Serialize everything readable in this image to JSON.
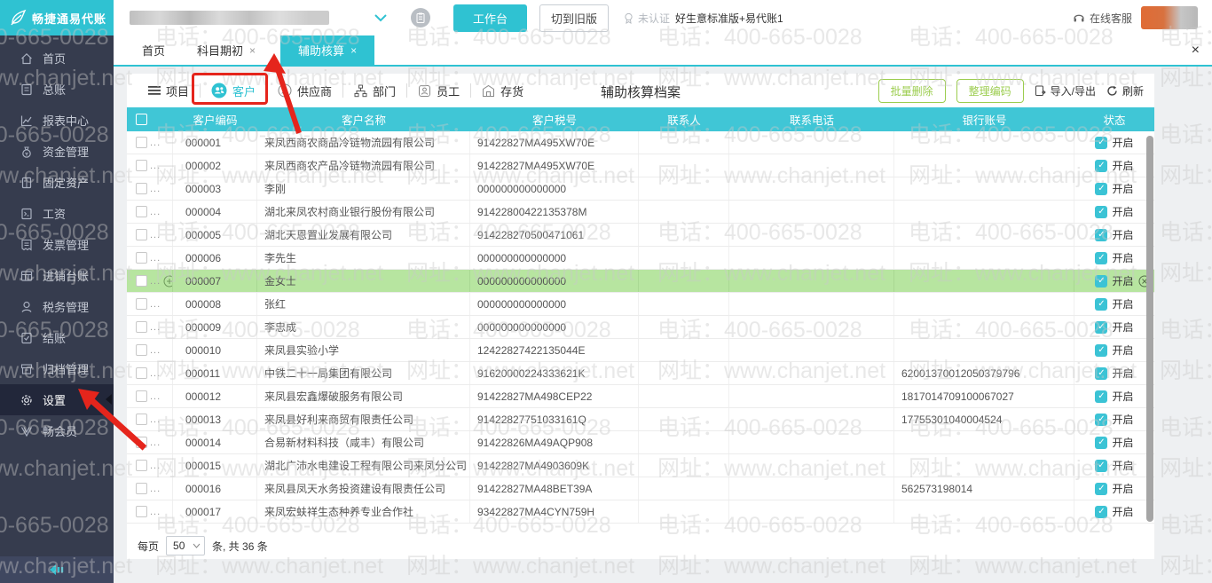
{
  "header": {
    "logo_text": "畅捷通易代账",
    "workbench_button": "工作台",
    "switch_old_button": "切到旧版",
    "cert_badge": "未认证",
    "product_name": "好生意标准版+易代账1",
    "online_service": "在线客服"
  },
  "tabs": {
    "items": [
      {
        "label": "首页",
        "closable": false
      },
      {
        "label": "科目期初",
        "closable": true
      },
      {
        "label": "辅助核算",
        "closable": true,
        "active": true
      }
    ],
    "close_glyph": "×"
  },
  "sidebar": {
    "items": [
      {
        "label": "首页"
      },
      {
        "label": "总账"
      },
      {
        "label": "报表中心"
      },
      {
        "label": "资金管理"
      },
      {
        "label": "固定资产"
      },
      {
        "label": "工资"
      },
      {
        "label": "发票管理"
      },
      {
        "label": "进销台账"
      },
      {
        "label": "税务管理"
      },
      {
        "label": "结账"
      },
      {
        "label": "归档管理"
      },
      {
        "label": "设置",
        "active": true
      },
      {
        "label": "畅会员"
      }
    ]
  },
  "toolbar": {
    "categories": [
      {
        "label": "项目"
      },
      {
        "label": "客户",
        "selected": true
      },
      {
        "label": "供应商"
      },
      {
        "label": "部门"
      },
      {
        "label": "员工"
      },
      {
        "label": "存货"
      }
    ],
    "title": "辅助核算档案",
    "actions": {
      "batch_delete": "批量删除",
      "organize_codes": "整理编码",
      "import_export": "导入/导出",
      "refresh": "刷新"
    }
  },
  "table": {
    "columns": [
      "客户编码",
      "客户名称",
      "客户税号",
      "联系人",
      "联系电话",
      "银行账号",
      "状态"
    ],
    "status_label": "开启",
    "rows": [
      {
        "code": "000001",
        "name": "来凤西商农商品冷链物流园有限公司",
        "tax": "91422827MA495XW70E",
        "contact": "",
        "phone": "",
        "bank": "",
        "status": "开启"
      },
      {
        "code": "000002",
        "name": "来凤西商农产品冷链物流园有限公司",
        "tax": "91422827MA495XW70E",
        "contact": "",
        "phone": "",
        "bank": "",
        "status": "开启"
      },
      {
        "code": "000003",
        "name": "李刚",
        "tax": "000000000000000",
        "contact": "",
        "phone": "",
        "bank": "",
        "status": "开启"
      },
      {
        "code": "000004",
        "name": "湖北来凤农村商业银行股份有限公司",
        "tax": "91422800422135378M",
        "contact": "",
        "phone": "",
        "bank": "",
        "status": "开启"
      },
      {
        "code": "000005",
        "name": "湖北天恩置业发展有限公司",
        "tax": "914228270500471061",
        "contact": "",
        "phone": "",
        "bank": "",
        "status": "开启"
      },
      {
        "code": "000006",
        "name": "李先生",
        "tax": "000000000000000",
        "contact": "",
        "phone": "",
        "bank": "",
        "status": "开启"
      },
      {
        "code": "000007",
        "name": "金女士",
        "tax": "000000000000000",
        "contact": "",
        "phone": "",
        "bank": "",
        "status": "开启",
        "highlighted": true
      },
      {
        "code": "000008",
        "name": "张红",
        "tax": "000000000000000",
        "contact": "",
        "phone": "",
        "bank": "",
        "status": "开启"
      },
      {
        "code": "000009",
        "name": "李忠成",
        "tax": "000000000000000",
        "contact": "",
        "phone": "",
        "bank": "",
        "status": "开启"
      },
      {
        "code": "000010",
        "name": "来凤县实验小学",
        "tax": "12422827422135044E",
        "contact": "",
        "phone": "",
        "bank": "",
        "status": "开启"
      },
      {
        "code": "000011",
        "name": "中铁二十一局集团有限公司",
        "tax": "91620000224333621K",
        "contact": "",
        "phone": "",
        "bank": "62001370012050379796",
        "status": "开启"
      },
      {
        "code": "000012",
        "name": "来凤县宏鑫爆破服务有限公司",
        "tax": "91422827MA498CEP22",
        "contact": "",
        "phone": "",
        "bank": "1817014709100067027",
        "status": "开启"
      },
      {
        "code": "000013",
        "name": "来凤县好利来商贸有限责任公司",
        "tax": "91422827751033161Q",
        "contact": "",
        "phone": "",
        "bank": "17755301040004524",
        "status": "开启"
      },
      {
        "code": "000014",
        "name": "合易新材料科技（咸丰）有限公司",
        "tax": "91422826MA49AQP908",
        "contact": "",
        "phone": "",
        "bank": "",
        "status": "开启"
      },
      {
        "code": "000015",
        "name": "湖北广沛水电建设工程有限公司来凤分公司",
        "tax": "91422827MA4903609K",
        "contact": "",
        "phone": "",
        "bank": "",
        "status": "开启"
      },
      {
        "code": "000016",
        "name": "来凤县凤天水务投资建设有限责任公司",
        "tax": "91422827MA48BET39A",
        "contact": "",
        "phone": "",
        "bank": "562573198014",
        "status": "开启"
      },
      {
        "code": "000017",
        "name": "来凤宏蚨祥生态种养专业合作社",
        "tax": "93422827MA4CYN759H",
        "contact": "",
        "phone": "",
        "bank": "",
        "status": "开启"
      }
    ]
  },
  "pagination": {
    "prefix": "每页",
    "page_size": "50",
    "suffix": "条, 共 36 条"
  },
  "watermark": {
    "phone": "电话：400-665-0028",
    "site": "网址：www.chanjet.net"
  }
}
